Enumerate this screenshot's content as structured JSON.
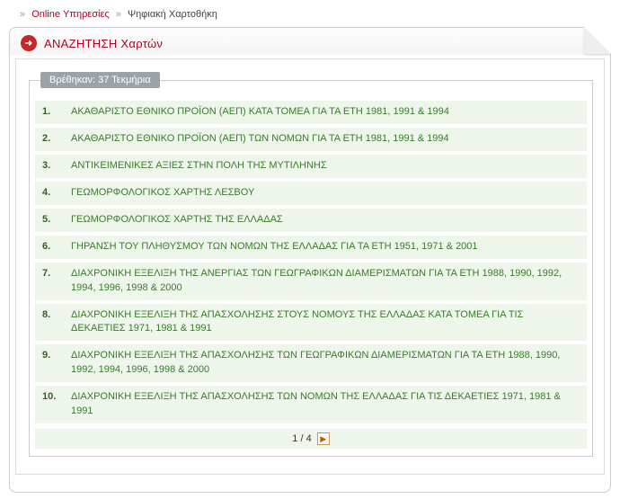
{
  "breadcrumb": {
    "sep1": "»",
    "item1": "Online Υπηρεσίες",
    "sep2": "»",
    "item2": "Ψηφιακή Χαρτοθήκη"
  },
  "panel": {
    "icon_glyph": "➜",
    "title": "ΑΝΑΖΗΤΗΣΗ Χαρτών"
  },
  "results": {
    "legend": "Βρέθηκαν: 37 Τεκμήρια",
    "items": [
      {
        "num": "1.",
        "title": "ΑΚΑΘΑΡΙΣΤΟ ΕΘΝΙΚΟ ΠΡΟΪΟΝ (ΑΕΠ) ΚΑΤΑ ΤΟΜΕΑ ΓΙΑ ΤΑ ΕΤΗ 1981, 1991 & 1994"
      },
      {
        "num": "2.",
        "title": "ΑΚΑΘΑΡΙΣΤΟ ΕΘΝΙΚΟ ΠΡΟΪΟΝ (ΑΕΠ) ΤΩΝ ΝΟΜΩΝ ΓΙΑ ΤΑ ΕΤΗ 1981, 1991 & 1994"
      },
      {
        "num": "3.",
        "title": "ΑΝΤΙΚΕΙΜΕΝΙΚΕΣ ΑΞΙΕΣ ΣΤΗΝ ΠΟΛΗ ΤΗΣ ΜΥΤΙΛΗΝΗΣ"
      },
      {
        "num": "4.",
        "title": "ΓΕΩΜΟΡΦΟΛΟΓΙΚΟΣ ΧΑΡΤΗΣ ΛΕΣΒΟΥ"
      },
      {
        "num": "5.",
        "title": "ΓΕΩΜΟΡΦΟΛΟΓΙΚΟΣ ΧΑΡΤΗΣ ΤΗΣ ΕΛΛΑΔΑΣ"
      },
      {
        "num": "6.",
        "title": "ΓΗΡΑΝΣΗ ΤΟΥ ΠΛΗΘΥΣΜΟΥ ΤΩΝ ΝΟΜΩΝ ΤΗΣ ΕΛΛΑΔΑΣ ΓΙΑ ΤΑ ΕΤΗ 1951, 1971 & 2001"
      },
      {
        "num": "7.",
        "title": "ΔΙΑΧΡΟΝΙΚΗ ΕΞΕΛΙΞΗ ΤΗΣ ΑΝΕΡΓΙΑΣ ΤΩΝ ΓΕΩΓΡΑΦΙΚΩΝ ΔΙΑΜΕΡΙΣΜΑΤΩΝ ΓΙΑ ΤΑ ΕΤΗ 1988, 1990, 1992, 1994, 1996, 1998 & 2000"
      },
      {
        "num": "8.",
        "title": "ΔΙΑΧΡΟΝΙΚΗ ΕΞΕΛΙΞΗ ΤΗΣ ΑΠΑΣΧΟΛΗΣΗΣ ΣΤΟΥΣ ΝΟΜΟΥΣ ΤΗΣ ΕΛΛΑΔΑΣ ΚΑΤΑ ΤΟΜΕΑ ΓΙΑ ΤΙΣ ΔΕΚΑΕΤΙΕΣ 1971, 1981 & 1991"
      },
      {
        "num": "9.",
        "title": "ΔΙΑΧΡΟΝΙΚΗ ΕΞΕΛΙΞΗ ΤΗΣ ΑΠΑΣΧΟΛΗΣΗΣ ΤΩΝ ΓΕΩΓΡΑΦΙΚΩΝ ΔΙΑΜΕΡΙΣΜΑΤΩΝ ΓΙΑ ΤΑ ΕΤΗ 1988, 1990, 1992, 1994, 1996, 1998 & 2000"
      },
      {
        "num": "10.",
        "title": "ΔΙΑΧΡΟΝΙΚΗ ΕΞΕΛΙΞΗ ΤΗΣ ΑΠΑΣΧΟΛΗΣΗΣ ΤΩΝ ΝΟΜΩΝ ΤΗΣ ΕΛΛΑΔΑΣ ΓΙΑ ΤΙΣ ΔΕΚΑΕΤΙΕΣ 1971, 1981 & 1991"
      }
    ]
  },
  "pager": {
    "text": "1  /  4",
    "next_glyph": "▶"
  }
}
